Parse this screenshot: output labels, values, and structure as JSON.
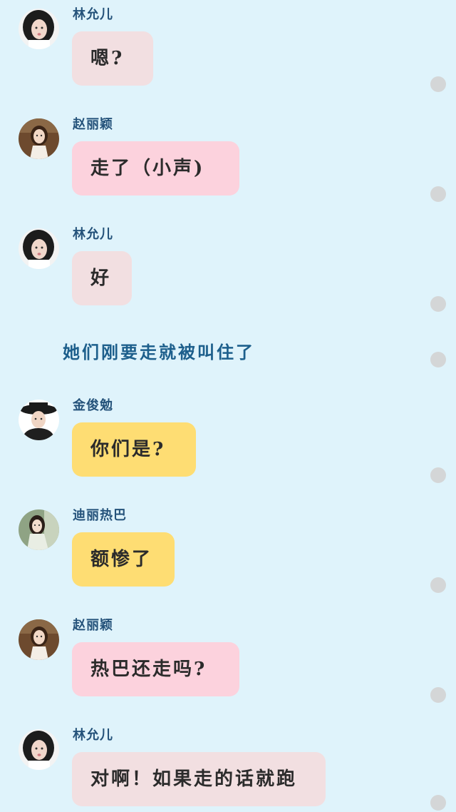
{
  "messages": [
    {
      "sender": "林允儿",
      "text": "嗯?",
      "avatar": "linyuner-avatar"
    },
    {
      "sender": "赵丽颖",
      "text": "走了（小声)",
      "avatar": "zhaoliying-avatar"
    },
    {
      "sender": "林允儿",
      "text": "好",
      "avatar": "linyuner-avatar"
    },
    {
      "sender": "金俊勉",
      "text": "你们是?",
      "avatar": "jinjunmian-avatar"
    },
    {
      "sender": "迪丽热巴",
      "text": "额惨了",
      "avatar": "dilireba-avatar"
    },
    {
      "sender": "赵丽颖",
      "text": "热巴还走吗?",
      "avatar": "zhaoliying-avatar"
    },
    {
      "sender": "林允儿",
      "text": "对啊！如果走的话就跑",
      "avatar": "linyuner-avatar"
    }
  ],
  "narration": "她们刚要走就被叫住了",
  "colors": {
    "background": "#dff3fb",
    "name_text": "#24527a",
    "narration_text": "#1d5f8c",
    "bubble_linyuner": "#f2dfe1",
    "bubble_zhaoliying": "#fcd2dd",
    "bubble_yellow": "#fedd73"
  }
}
